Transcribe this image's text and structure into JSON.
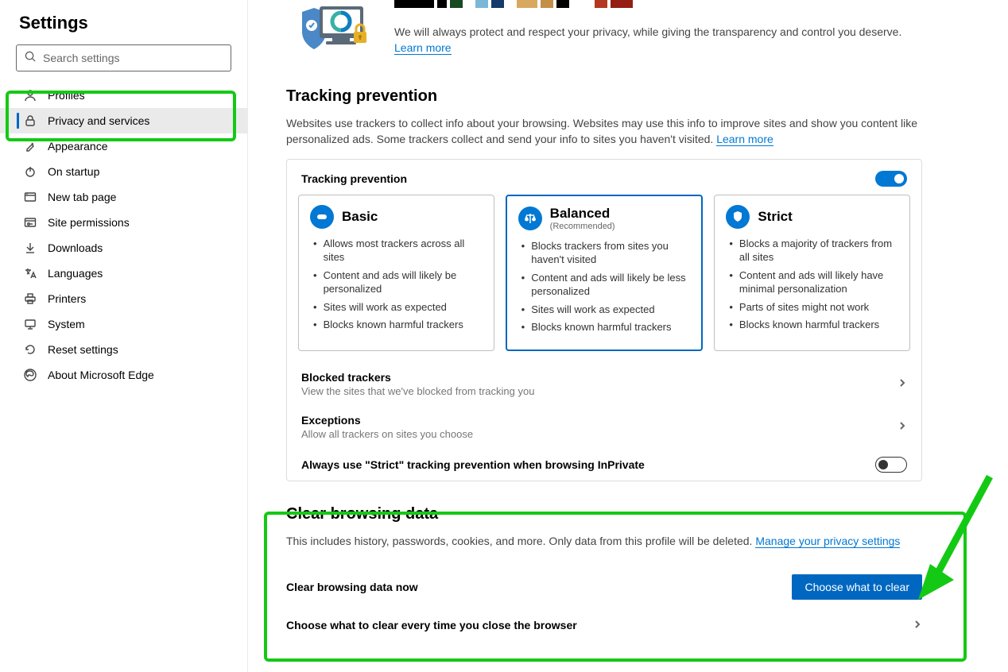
{
  "header": {
    "title": "Settings"
  },
  "search": {
    "placeholder": "Search settings"
  },
  "nav": {
    "items": [
      {
        "label": "Profiles"
      },
      {
        "label": "Privacy and services"
      },
      {
        "label": "Appearance"
      },
      {
        "label": "On startup"
      },
      {
        "label": "New tab page"
      },
      {
        "label": "Site permissions"
      },
      {
        "label": "Downloads"
      },
      {
        "label": "Languages"
      },
      {
        "label": "Printers"
      },
      {
        "label": "System"
      },
      {
        "label": "Reset settings"
      },
      {
        "label": "About Microsoft Edge"
      }
    ]
  },
  "banner": {
    "text": "We will always protect and respect your privacy, while giving the transparency and control you deserve. ",
    "link": "Learn more"
  },
  "tracking": {
    "heading": "Tracking prevention",
    "desc": "Websites use trackers to collect info about your browsing. Websites may use this info to improve sites and show you content like personalized ads. Some trackers collect and send your info to sites you haven't visited. ",
    "link": "Learn more",
    "card_label": "Tracking prevention",
    "levels": [
      {
        "title": "Basic",
        "bullets": [
          "Allows most trackers across all sites",
          "Content and ads will likely be personalized",
          "Sites will work as expected",
          "Blocks known harmful trackers"
        ]
      },
      {
        "title": "Balanced",
        "sub": "(Recommended)",
        "bullets": [
          "Blocks trackers from sites you haven't visited",
          "Content and ads will likely be less personalized",
          "Sites will work as expected",
          "Blocks known harmful trackers"
        ]
      },
      {
        "title": "Strict",
        "bullets": [
          "Blocks a majority of trackers from all sites",
          "Content and ads will likely have minimal personalization",
          "Parts of sites might not work",
          "Blocks known harmful trackers"
        ]
      }
    ],
    "blocked": {
      "title": "Blocked trackers",
      "desc": "View the sites that we've blocked from tracking you"
    },
    "exceptions": {
      "title": "Exceptions",
      "desc": "Allow all trackers on sites you choose"
    },
    "inprivate": {
      "label": "Always use \"Strict\" tracking prevention when browsing InPrivate"
    }
  },
  "clear": {
    "heading": "Clear browsing data",
    "desc": "This includes history, passwords, cookies, and more. Only data from this profile will be deleted. ",
    "link": "Manage your privacy settings",
    "now": {
      "title": "Clear browsing data now",
      "button": "Choose what to clear"
    },
    "close": {
      "title": "Choose what to clear every time you close the browser"
    }
  }
}
